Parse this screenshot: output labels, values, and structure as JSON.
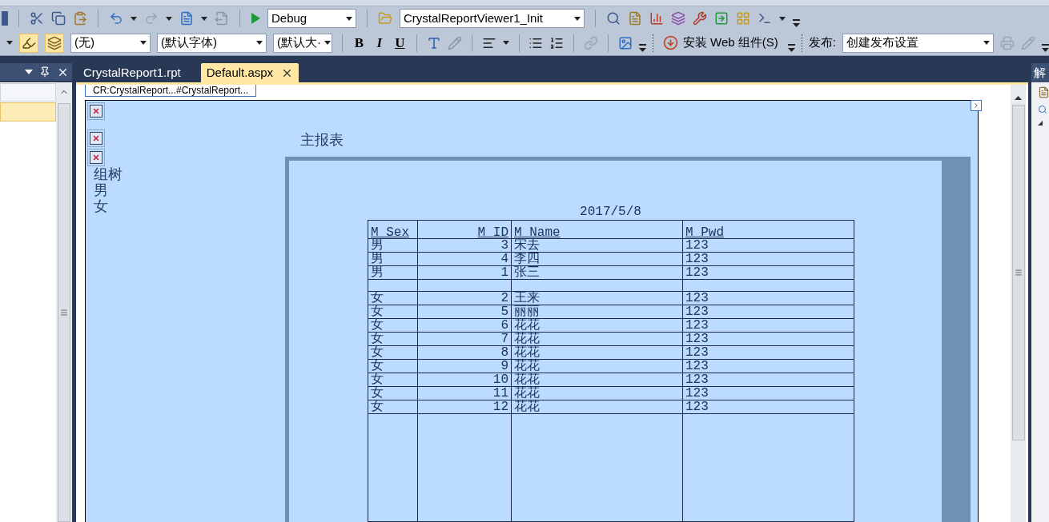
{
  "toolbar_standard": {
    "configuration": "Debug",
    "method": "CrystalReportViewer1_Init"
  },
  "toolbar_format": {
    "style": "(无)",
    "font": "(默认字体)",
    "size": "(默认大·",
    "bold": "B",
    "italic": "I",
    "underline": "U",
    "install_button": "安装 Web 组件(S)",
    "publish_label": "发布:",
    "publish_value": "创建发布设置"
  },
  "tabs": [
    {
      "label": "CrystalReport1.rpt",
      "selected": false
    },
    {
      "label": "Default.aspx",
      "selected": true
    }
  ],
  "design_tag": "CR:CrystalReport...#CrystalReport...",
  "group_tree": {
    "title": "组树",
    "items": [
      "男",
      "女"
    ]
  },
  "report": {
    "title": "主报表",
    "date": "2017/5/8",
    "columns": [
      "M_Sex",
      "M_ID",
      "M_Name",
      "M_Pwd"
    ],
    "rows": [
      {
        "kind": "data",
        "cells": [
          "男",
          "3",
          "宋去",
          "123"
        ]
      },
      {
        "kind": "data",
        "cells": [
          "男",
          "4",
          "李四",
          "123"
        ]
      },
      {
        "kind": "data",
        "cells": [
          "男",
          "1",
          "张三",
          "123"
        ]
      },
      {
        "kind": "gap"
      },
      {
        "kind": "data",
        "cells": [
          "女",
          "2",
          "王来",
          "123"
        ]
      },
      {
        "kind": "data",
        "cells": [
          "女",
          "5",
          "丽丽",
          "123"
        ]
      },
      {
        "kind": "data",
        "cells": [
          "女",
          "6",
          "花花",
          "123"
        ]
      },
      {
        "kind": "data",
        "cells": [
          "女",
          "7",
          "花花",
          "123"
        ]
      },
      {
        "kind": "data",
        "cells": [
          "女",
          "8",
          "花花",
          "123"
        ]
      },
      {
        "kind": "data",
        "cells": [
          "女",
          "9",
          "花花",
          "123"
        ]
      },
      {
        "kind": "data",
        "cells": [
          "女",
          "10",
          "花花",
          "123"
        ]
      },
      {
        "kind": "data",
        "cells": [
          "女",
          "11",
          "花花",
          "123"
        ]
      },
      {
        "kind": "data",
        "cells": [
          "女",
          "12",
          "花花",
          "123"
        ]
      }
    ]
  },
  "right_panel": {
    "title": "解"
  }
}
